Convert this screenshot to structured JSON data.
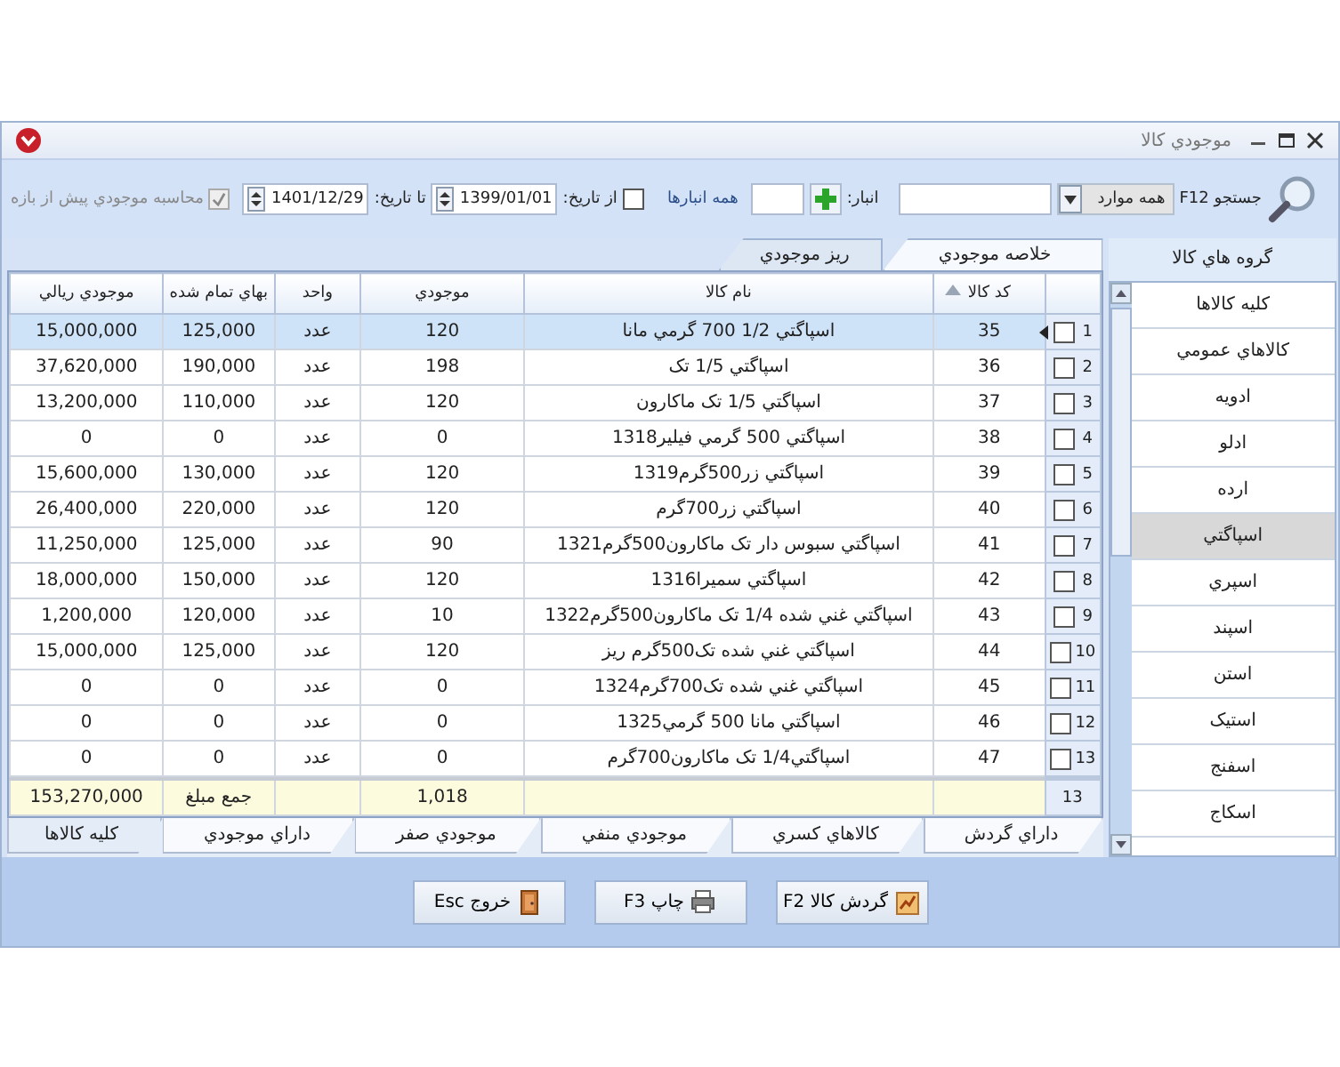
{
  "window": {
    "title": "موجودي کالا"
  },
  "toolbar": {
    "search_label": "جستجو F12",
    "filter": {
      "value": "همه موارد"
    },
    "warehouse_label": "انبار:",
    "all_warehouses": "همه انبارها",
    "from_date": {
      "label": "از تاريخ:",
      "checked": false,
      "value": "1399/01/01"
    },
    "to_date": {
      "label": "تا تاريخ:",
      "value": "1401/12/29"
    },
    "period_option": {
      "label": "محاسبه موجودي پيش از بازه",
      "checked": true,
      "disabled": true
    }
  },
  "top_tabs": [
    {
      "label": "خلاصه موجودي",
      "selected": true
    },
    {
      "label": "ريز موجودي",
      "selected": false
    }
  ],
  "table": {
    "columns": [
      {
        "label": "کد کالا",
        "sorted": true
      },
      {
        "label": "نام کالا",
        "sorted": false
      },
      {
        "label": "موجودي",
        "sorted": false
      },
      {
        "label": "واحد",
        "sorted": false
      },
      {
        "label": "بهاي تمام شده",
        "sorted": false
      },
      {
        "label": "موجودي ريالي",
        "sorted": false
      }
    ],
    "rows": [
      {
        "number": "1",
        "checked": false,
        "selected": true,
        "cells": [
          "35",
          "اسپاگتي 1/2 700 گرمي مانا",
          "120",
          "عدد",
          "125,000",
          "15,000,000"
        ]
      },
      {
        "number": "2",
        "checked": false,
        "selected": false,
        "cells": [
          "36",
          "اسپاگتي 1/5 تک",
          "198",
          "عدد",
          "190,000",
          "37,620,000"
        ]
      },
      {
        "number": "3",
        "checked": false,
        "selected": false,
        "cells": [
          "37",
          "اسپاگتي 1/5 تک ماکارون",
          "120",
          "عدد",
          "110,000",
          "13,200,000"
        ]
      },
      {
        "number": "4",
        "checked": false,
        "selected": false,
        "cells": [
          "38",
          "اسپاگتي 500 گرمي فيلير1318",
          "0",
          "عدد",
          "0",
          "0"
        ]
      },
      {
        "number": "5",
        "checked": false,
        "selected": false,
        "cells": [
          "39",
          "اسپاگتي زر500گرم1319",
          "120",
          "عدد",
          "130,000",
          "15,600,000"
        ]
      },
      {
        "number": "6",
        "checked": false,
        "selected": false,
        "cells": [
          "40",
          "اسپاگتي زر700گرم",
          "120",
          "عدد",
          "220,000",
          "26,400,000"
        ]
      },
      {
        "number": "7",
        "checked": false,
        "selected": false,
        "cells": [
          "41",
          "اسپاگتي سبوس دار تک ماکارون500گرم1321",
          "90",
          "عدد",
          "125,000",
          "11,250,000"
        ]
      },
      {
        "number": "8",
        "checked": false,
        "selected": false,
        "cells": [
          "42",
          "اسپاگتي سميرا1316",
          "120",
          "عدد",
          "150,000",
          "18,000,000"
        ]
      },
      {
        "number": "9",
        "checked": false,
        "selected": false,
        "cells": [
          "43",
          "اسپاگتي غني شده 1/4 تک ماکارون500گرم1322",
          "10",
          "عدد",
          "120,000",
          "1,200,000"
        ]
      },
      {
        "number": "10",
        "checked": false,
        "selected": false,
        "cells": [
          "44",
          "اسپاگتي غني شده تک500گرم ريز",
          "120",
          "عدد",
          "125,000",
          "15,000,000"
        ]
      },
      {
        "number": "11",
        "checked": false,
        "selected": false,
        "cells": [
          "45",
          "اسپاگتي غني شده تک700گرم1324",
          "0",
          "عدد",
          "0",
          "0"
        ]
      },
      {
        "number": "12",
        "checked": false,
        "selected": false,
        "cells": [
          "46",
          "اسپاگتي مانا 500 گرمي1325",
          "0",
          "عدد",
          "0",
          "0"
        ]
      },
      {
        "number": "13",
        "checked": false,
        "selected": false,
        "cells": [
          "47",
          "اسپاگتي1/4 تک ماکارون700گرم",
          "0",
          "عدد",
          "0",
          "0"
        ]
      }
    ],
    "footer": {
      "count": "13",
      "quantity_total": "1,018",
      "total_label": "جمع مبلغ",
      "value_total": "153,270,000"
    }
  },
  "bottom_tabs": [
    {
      "label": "داراي گردش",
      "selected": false
    },
    {
      "label": "کالاهاي کسري",
      "selected": false
    },
    {
      "label": "موجودي منفي",
      "selected": false
    },
    {
      "label": "موجودي صفر",
      "selected": false
    },
    {
      "label": "داراي موجودي",
      "selected": false
    },
    {
      "label": "کليه کالاها",
      "selected": true
    }
  ],
  "buttons": [
    {
      "label": "گردش کالا F2",
      "kind": "turnover"
    },
    {
      "label": "چاپ F3",
      "kind": "print"
    },
    {
      "label": "خروج Esc",
      "kind": "exit"
    }
  ],
  "sidebar": {
    "title": "گروه هاي کالا",
    "items": [
      {
        "label": "کليه کالاها",
        "selected": false
      },
      {
        "label": "کالاهاي عمومي",
        "selected": false
      },
      {
        "label": "ادويه",
        "selected": false
      },
      {
        "label": "ادلو",
        "selected": false
      },
      {
        "label": "ارده",
        "selected": false
      },
      {
        "label": "اسپاگتي",
        "selected": true
      },
      {
        "label": "اسپري",
        "selected": false
      },
      {
        "label": "اسپند",
        "selected": false
      },
      {
        "label": "استن",
        "selected": false
      },
      {
        "label": "استيک",
        "selected": false
      },
      {
        "label": "اسفنج",
        "selected": false
      },
      {
        "label": "اسکاج",
        "selected": false
      }
    ]
  }
}
